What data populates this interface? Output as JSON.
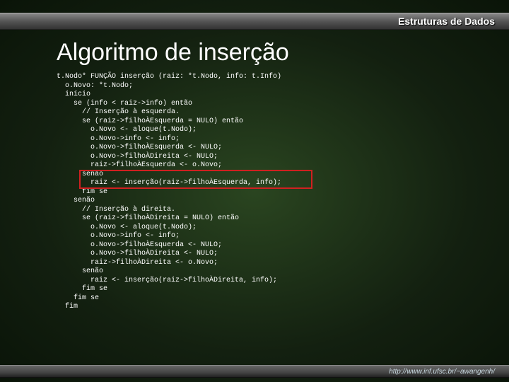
{
  "header": "Estruturas de Dados",
  "title": "Algoritmo de inserção",
  "code_lines": [
    "t.Nodo* FUNÇÃO inserção (raiz: *t.Nodo, info: t.Info)",
    "  o.Novo: *t.Nodo;",
    "  início",
    "    se (info < raiz->info) então",
    "      // Inserção à esquerda.",
    "      se (raiz->filhoÀEsquerda = NULO) então",
    "        o.Novo <- aloque(t.Nodo);",
    "        o.Novo->info <- info;",
    "        o.Novo->filhoÀEsquerda <- NULO;",
    "        o.Novo->filhoÀDireita <- NULO;",
    "        raiz->filhoÀEsquerda <- o.Novo;",
    "      senão",
    "        raiz <- inserção(raiz->filhoÀEsquerda, info);",
    "      fim se",
    "    senão",
    "      // Inserção à direita.",
    "      se (raiz->filhoÀDireita = NULO) então",
    "        o.Novo <- aloque(t.Nodo);",
    "        o.Novo->info <- info;",
    "        o.Novo->filhoÀEsquerda <- NULO;",
    "        o.Novo->filhoÀDireita <- NULO;",
    "        raiz->filhoÀDireita <- o.Novo;",
    "      senão",
    "        raiz <- inserção(raiz->filhoÀDireita, info);",
    "      fim se",
    "    fim se",
    "  fim"
  ],
  "highlight": {
    "first_line_index": 11,
    "last_line_index": 12
  },
  "footer": "http://www.inf.ufsc.br/~awangenh/"
}
